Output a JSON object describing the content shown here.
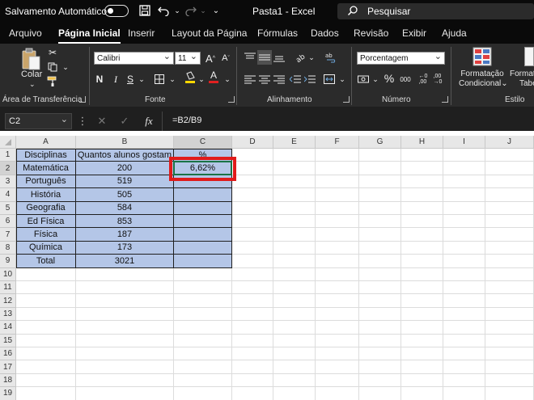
{
  "titlebar": {
    "autosave_label": "Salvamento Automático",
    "doc_title": "Pasta1  -  Excel",
    "search_placeholder": "Pesquisar"
  },
  "tabs": [
    {
      "label": "Arquivo"
    },
    {
      "label": "Página Inicial",
      "active": true
    },
    {
      "label": "Inserir"
    },
    {
      "label": "Layout da Página"
    },
    {
      "label": "Fórmulas"
    },
    {
      "label": "Dados"
    },
    {
      "label": "Revisão"
    },
    {
      "label": "Exibir"
    },
    {
      "label": "Ajuda"
    }
  ],
  "ribbon": {
    "clipboard": {
      "paste_label": "Colar",
      "group_label": "Área de Transferência"
    },
    "font": {
      "font_name": "Calibri",
      "font_size": "11",
      "group_label": "Fonte",
      "bold": "N",
      "italic": "I",
      "underline": "S",
      "font_color": "#e02020",
      "fill_color": "#ffd700"
    },
    "alignment": {
      "group_label": "Alinhamento"
    },
    "number": {
      "format": "Porcentagem",
      "group_label": "Número",
      "percent": "%",
      "comma": "000"
    },
    "styles": {
      "cond_format_line1": "Formatação",
      "cond_format_line2": "Condicional",
      "format_table_line1": "Formatar",
      "format_table_line2": "Tabe",
      "group_label": "Estilo"
    }
  },
  "formula_bar": {
    "name_box": "C2",
    "fx": "fx",
    "formula": "=B2/B9"
  },
  "sheet": {
    "columns": [
      "A",
      "B",
      "C",
      "D",
      "E",
      "F",
      "G",
      "H",
      "I",
      "J"
    ],
    "selected_column": "C",
    "rows": [
      "1",
      "2",
      "3",
      "4",
      "5",
      "6",
      "7",
      "8",
      "9",
      "10",
      "11",
      "12",
      "13",
      "14",
      "15",
      "16",
      "17",
      "18",
      "19",
      "20"
    ],
    "selected_row": "2",
    "header_row": {
      "a": "Disciplinas",
      "b": "Quantos alunos gostam",
      "c": "%"
    },
    "data": [
      {
        "a": "Matemática",
        "b": "200",
        "c": "6,62%"
      },
      {
        "a": "Português",
        "b": "519",
        "c": ""
      },
      {
        "a": "História",
        "b": "505",
        "c": ""
      },
      {
        "a": "Geografia",
        "b": "584",
        "c": ""
      },
      {
        "a": "Ed Física",
        "b": "853",
        "c": ""
      },
      {
        "a": "Física",
        "b": "187",
        "c": ""
      },
      {
        "a": "Química",
        "b": "173",
        "c": ""
      },
      {
        "a": "Total",
        "b": "3021",
        "c": ""
      }
    ],
    "fill_color": "#b4c6e7",
    "highlight_color": "#e01b1b",
    "selection_color": "#1a7346"
  }
}
